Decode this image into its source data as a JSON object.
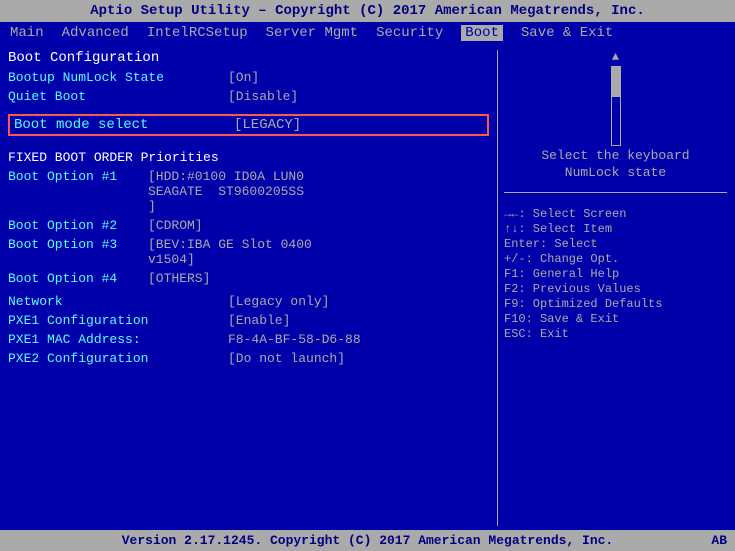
{
  "title": "Aptio Setup Utility – Copyright (C) 2017 American Megatrends, Inc.",
  "menu": {
    "items": [
      {
        "label": "Main",
        "active": false
      },
      {
        "label": "Advanced",
        "active": false
      },
      {
        "label": "IntelRCSetup",
        "active": false
      },
      {
        "label": "Server Mgmt",
        "active": false
      },
      {
        "label": "Security",
        "active": false
      },
      {
        "label": "Boot",
        "active": true
      },
      {
        "label": "Save & Exit",
        "active": false
      }
    ]
  },
  "left": {
    "section_title": "Boot Configuration",
    "bootup_numlock_label": "Bootup NumLock State",
    "bootup_numlock_value": "[On]",
    "quiet_boot_label": "Quiet Boot",
    "quiet_boot_value": "[Disable]",
    "boot_mode_label": "Boot mode select",
    "boot_mode_value": "[LEGACY]",
    "fixed_boot_title": "FIXED BOOT ORDER Priorities",
    "boot_options": [
      {
        "label": "Boot Option #1",
        "value": "[HDD:#0100 ID0A LUN0 SEAGATE  ST9600205SS]"
      },
      {
        "label": "Boot Option #2",
        "value": "[CDROM]"
      },
      {
        "label": "Boot Option #3",
        "value": "[BEV:IBA GE Slot 0400 v1504]"
      },
      {
        "label": "Boot Option #4",
        "value": "[OTHERS]"
      }
    ],
    "network_label": "Network",
    "network_value": "[Legacy only]",
    "pxe1_config_label": "PXE1 Configuration",
    "pxe1_config_value": "[Enable]",
    "pxe1_mac_label": "PXE1 MAC Address:",
    "pxe1_mac_value": "F8-4A-BF-58-D6-88",
    "pxe2_config_label": "PXE2 Configuration",
    "pxe2_config_value": "[Do not launch]"
  },
  "right": {
    "help_line1": "Select the keyboard",
    "help_line2": "NumLock state",
    "keybinds": [
      "→←: Select Screen",
      "↑↓: Select Item",
      "Enter: Select",
      "+/-: Change Opt.",
      "F1: General Help",
      "F2: Previous Values",
      "F9: Optimized Defaults",
      "F10: Save & Exit",
      "ESC: Exit"
    ]
  },
  "footer": "Version 2.17.1245. Copyright (C) 2017 American Megatrends, Inc.",
  "footer_badge": "AB"
}
